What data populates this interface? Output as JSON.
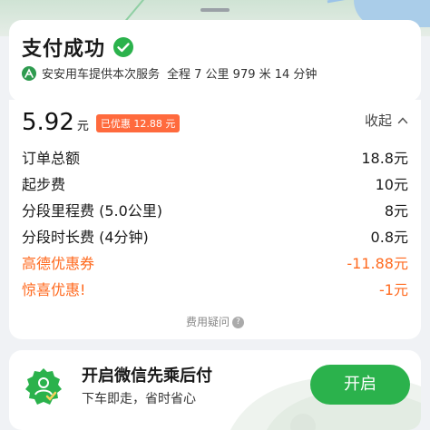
{
  "header": {
    "title": "支付成功",
    "service_text": "安安用车提供本次服务",
    "trip_summary": "全程 7 公里 979 米 14 分钟"
  },
  "fee": {
    "price": "5.92",
    "unit": "元",
    "discount_badge": "已优惠 12.88 元",
    "collapse_label": "收起",
    "items": [
      {
        "label": "订单总额",
        "value": "18.8元",
        "type": "normal"
      },
      {
        "label": "起步费",
        "value": "10元",
        "type": "normal"
      },
      {
        "label": "分段里程费 (5.0公里)",
        "value": "8元",
        "type": "normal"
      },
      {
        "label": "分段时长费 (4分钟)",
        "value": "0.8元",
        "type": "normal"
      },
      {
        "label": "高德优惠券",
        "value": "-11.88元",
        "type": "discount"
      },
      {
        "label": "惊喜优惠!",
        "value": "-1元",
        "type": "discount"
      }
    ],
    "help_label": "费用疑问"
  },
  "promo": {
    "title": "开启微信先乘后付",
    "subtitle": "下车即走，省时省心",
    "button_label": "开启"
  },
  "colors": {
    "accent_green": "#2bb24c",
    "discount_orange": "#ff6a1f",
    "badge_orange": "#ff6a3d"
  },
  "icons": {
    "success": "check-circle-icon",
    "service": "anan-logo-icon",
    "collapse": "chevron-up-icon",
    "help": "question-circle-icon",
    "promo": "shield-badge-icon"
  }
}
